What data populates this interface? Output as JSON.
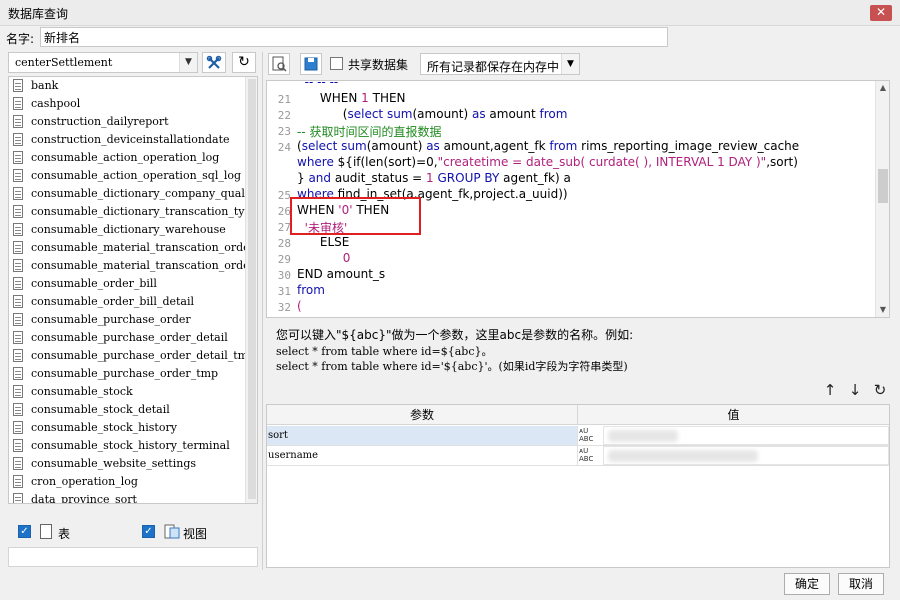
{
  "window": {
    "title": "数据库查询",
    "close_glyph": "✕"
  },
  "name_field": {
    "label": "名字:",
    "value": "新排名"
  },
  "datasource": {
    "selected": "centerSettlement"
  },
  "tables": [
    "bank",
    "cashpool",
    "construction_dailyreport",
    "construction_deviceinstallationdate",
    "consumable_action_operation_log",
    "consumable_action_operation_sql_log",
    "consumable_dictionary_company_qualif",
    "consumable_dictionary_transcation_ty",
    "consumable_dictionary_warehouse",
    "consumable_material_transcation_orde",
    "consumable_material_transcation_orde",
    "consumable_order_bill",
    "consumable_order_bill_detail",
    "consumable_purchase_order",
    "consumable_purchase_order_detail",
    "consumable_purchase_order_detail_tmp",
    "consumable_purchase_order_tmp",
    "consumable_stock",
    "consumable_stock_detail",
    "consumable_stock_history",
    "consumable_stock_history_terminal",
    "consumable_website_settings",
    "cron_operation_log",
    "data_province_sort"
  ],
  "filters": {
    "table_label": "表",
    "view_label": "视图"
  },
  "query_toolbar": {
    "share_label": "共享数据集",
    "mode_selected": "所有记录都保存在内存中"
  },
  "editor": {
    "line_numbers": [
      "21",
      "22",
      "23",
      "24",
      "",
      "",
      "25",
      "26",
      "27",
      "28",
      "29",
      "30",
      "31",
      "32"
    ]
  },
  "hint": {
    "line1": "您可以键入\"${abc}\"做为一个参数，这里abc是参数的名称。例如:",
    "line2": "select * from table where id=${abc}。",
    "line3": "select * from table where id='${abc}'。(如果id字段为字符串类型)"
  },
  "params": {
    "col_name": "参数",
    "col_value": "值",
    "rows": [
      {
        "name": "sort",
        "value": ""
      },
      {
        "name": "username",
        "value": ""
      }
    ]
  },
  "buttons": {
    "ok": "确定",
    "cancel": "取消"
  }
}
